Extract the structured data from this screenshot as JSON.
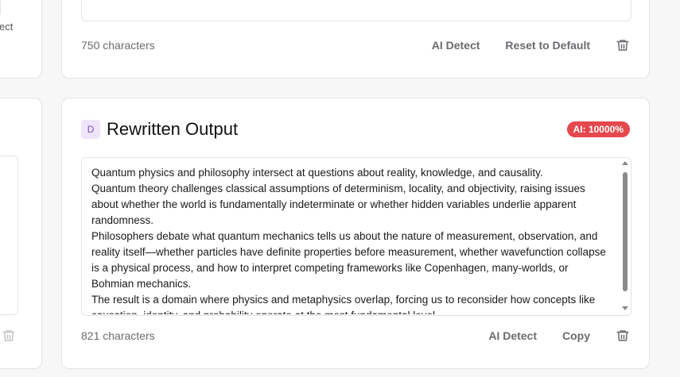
{
  "left_panel": {
    "partial_action_label": "ect"
  },
  "top_card": {
    "char_count": "750 characters",
    "ai_detect_label": "AI Detect",
    "reset_label": "Reset to Default"
  },
  "output_card": {
    "avatar_letter": "D",
    "title": "Rewritten Output",
    "ai_badge": "AI: 10000%",
    "text": "Quantum physics and philosophy intersect at questions about reality, knowledge, and causality.\nQuantum theory challenges classical assumptions of determinism, locality, and objectivity, raising issues about whether the world is fundamentally indeterminate or whether hidden variables underlie apparent randomness.\nPhilosophers debate what quantum mechanics tells us about the nature of measurement, observation, and reality itself—whether particles have definite properties before measurement, whether wavefunction collapse is a physical process, and how to interpret competing frameworks like Copenhagen, many-worlds, or Bohmian mechanics.\nThe result is a domain where physics and metaphysics overlap, forcing us to reconsider how concepts like causation, identity, and probability operate at the most fundamental level.",
    "char_count": "821 characters",
    "ai_detect_label": "AI Detect",
    "copy_label": "Copy"
  },
  "colors": {
    "badge": "#e5484d",
    "avatar_bg": "#efe5fb",
    "avatar_fg": "#7c4dbb"
  },
  "icons": [
    "trash-icon",
    "chevron-up-icon",
    "chevron-down-icon"
  ]
}
